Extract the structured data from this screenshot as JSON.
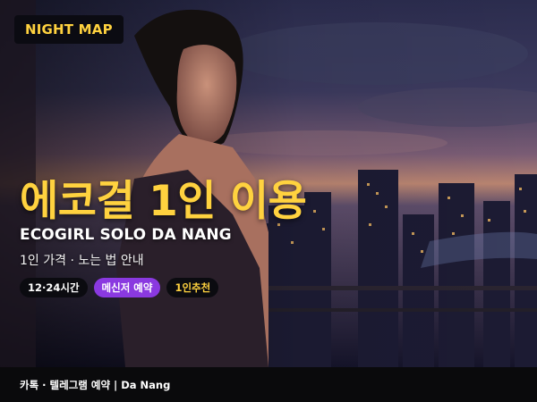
{
  "badge": "NIGHT MAP",
  "headline": "에코걸 1인 이용",
  "subtitle": "ECOGIRL SOLO DA NANG",
  "description": "1인 가격 · 노는 법 안내",
  "chips": [
    {
      "label": "12·24시간"
    },
    {
      "label": "메신저 예약"
    },
    {
      "label": "1인추천"
    }
  ],
  "footer": "카톡 · 텔레그램 예약 | Da Nang",
  "colors": {
    "accent_yellow": "#ffd23f",
    "chip_purple": "#8a39e0",
    "footer_bg": "#0a0a0c"
  }
}
